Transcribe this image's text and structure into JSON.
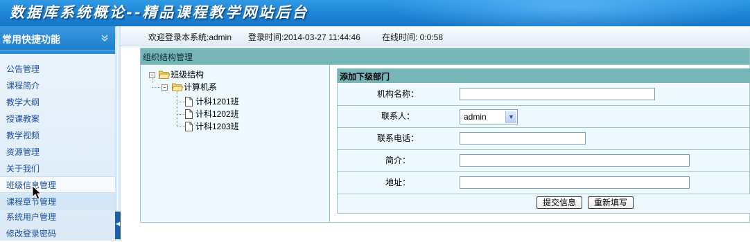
{
  "header": {
    "title": "数据库系统概论--精品课程教学网站后台"
  },
  "sidebar": {
    "title": "常用快捷功能",
    "items": [
      {
        "label": "公告管理"
      },
      {
        "label": "课程简介"
      },
      {
        "label": "教学大纲"
      },
      {
        "label": "授课教案"
      },
      {
        "label": "教学视频"
      },
      {
        "label": "资源管理"
      },
      {
        "label": "关于我们"
      },
      {
        "label": "班级信息管理"
      },
      {
        "label": "课程章节管理"
      },
      {
        "label": "系统用户管理"
      },
      {
        "label": "修改登录密码"
      }
    ]
  },
  "infobar": {
    "welcome": "欢迎登录本系统:admin",
    "login_time": "登录时间:2014-03-27 11:44:46",
    "online_time": "在线时间: 0:0:58"
  },
  "panel": {
    "title": "组织结构管理"
  },
  "tree": {
    "root": "班级结构",
    "department": "计算机系",
    "classes": [
      "计科1201班",
      "计科1202班",
      "计科1203班"
    ]
  },
  "form": {
    "title": "添加下级部门",
    "fields": {
      "name_label": "机构名称：",
      "contact_label": "联系人：",
      "contact_value": "admin",
      "phone_label": "联系电话：",
      "intro_label": "简介：",
      "address_label": "地址："
    },
    "submit_label": "提交信息",
    "reset_label": "重新填写"
  },
  "colors": {
    "banner": "#1d84d6",
    "sidebar": "#2a8bd6",
    "panel_header": "#76b5b8",
    "menu_text": "#1a4f9c"
  }
}
